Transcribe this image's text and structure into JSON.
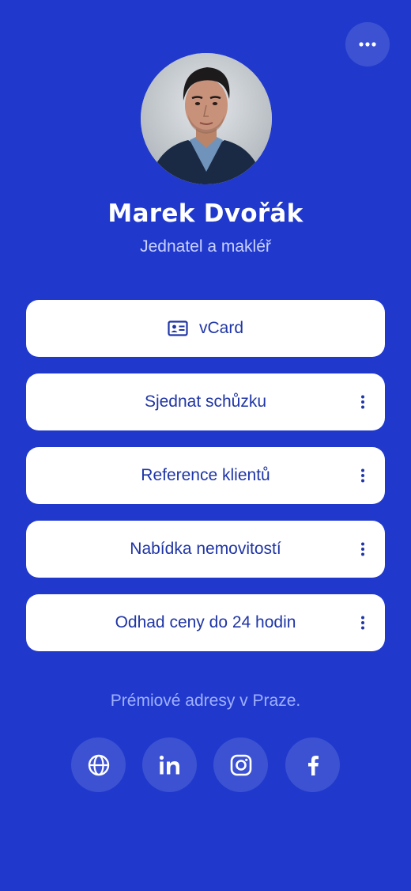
{
  "header": {
    "more_icon": "more-horizontal-icon"
  },
  "profile": {
    "name": "Marek Dvořák",
    "title": "Jednatel a makléř"
  },
  "links": [
    {
      "label": "vCard",
      "icon": "contact-card-icon",
      "has_menu": false
    },
    {
      "label": "Sjednat schůzku",
      "has_menu": true
    },
    {
      "label": "Reference klientů",
      "has_menu": true
    },
    {
      "label": "Nabídka nemovitostí",
      "has_menu": true
    },
    {
      "label": "Odhad ceny do 24 hodin",
      "has_menu": true
    }
  ],
  "tagline": "Prémiové adresy v Praze.",
  "social": [
    {
      "icon": "globe-icon"
    },
    {
      "icon": "linkedin-icon"
    },
    {
      "icon": "instagram-icon"
    },
    {
      "icon": "facebook-icon"
    }
  ],
  "colors": {
    "background": "#2039cc",
    "button_bg": "#ffffff",
    "button_text": "#1f35a6",
    "subtitle": "#c9d1ff",
    "tagline": "#9fb0ff"
  }
}
